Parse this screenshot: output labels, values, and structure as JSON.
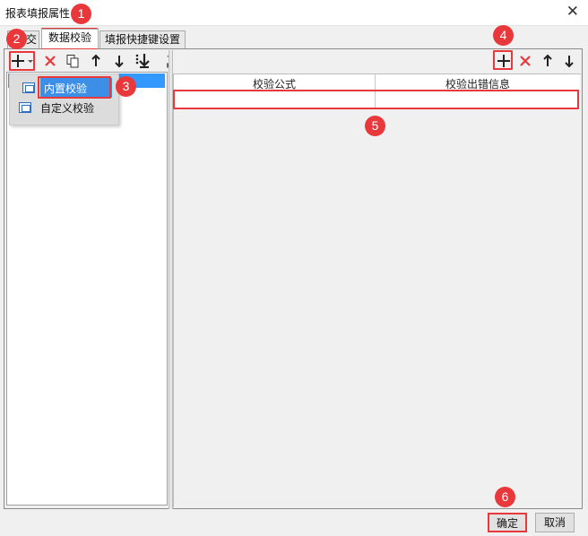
{
  "window": {
    "title": "报表填报属性",
    "close_icon": "close-icon"
  },
  "tabs": [
    {
      "label": "交",
      "active": false
    },
    {
      "label": "数据校验",
      "active": true
    },
    {
      "label": "填报快捷键设置",
      "active": false
    }
  ],
  "left_toolbar": {
    "add_icon": "plus-icon",
    "dropdown_icon": "caret-down-icon",
    "delete_icon": "delete-x-icon",
    "copy_icon": "copy-icon",
    "up_icon": "arrow-up-icon",
    "down_icon": "arrow-down-icon",
    "move_bottom_icon": "move-bottom-icon"
  },
  "add_menu": {
    "items": [
      {
        "label": "内置校验",
        "icon": "builtin-check-icon",
        "selected": true
      },
      {
        "label": "自定义校验",
        "icon": "custom-check-icon",
        "selected": false
      }
    ]
  },
  "right_toolbar": {
    "add_icon": "plus-icon",
    "delete_icon": "delete-x-icon",
    "up_icon": "arrow-up-icon",
    "down_icon": "arrow-down-icon"
  },
  "grid": {
    "columns": [
      "校验公式",
      "校验出错信息"
    ],
    "rows": [
      [
        "",
        ""
      ]
    ]
  },
  "badges": [
    "1",
    "2",
    "3",
    "4",
    "5",
    "6"
  ],
  "footer": {
    "ok_label": "确定",
    "cancel_label": "取消"
  },
  "colors": {
    "highlight": "#e8383b",
    "selection": "#3399ff",
    "delete_icon": "#e8383b"
  }
}
